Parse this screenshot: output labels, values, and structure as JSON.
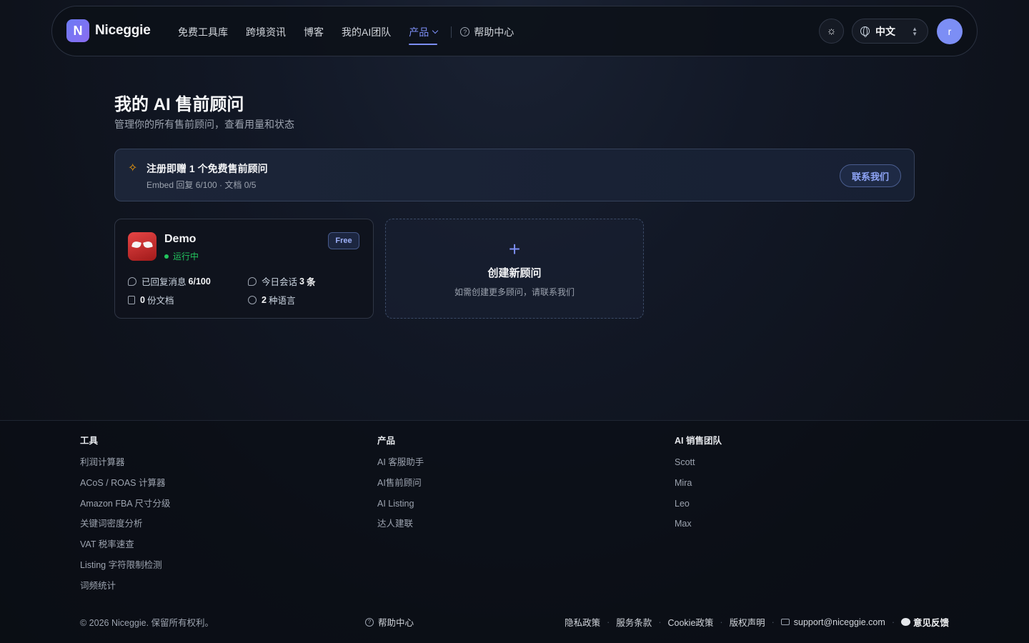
{
  "nav": {
    "logo_letter": "N",
    "logo_text": "Niceggie",
    "items": [
      {
        "label": "免费工具库"
      },
      {
        "label": "跨境资讯"
      },
      {
        "label": "博客"
      },
      {
        "label": "我的AI团队"
      },
      {
        "label": "产品",
        "active": true
      }
    ],
    "help_label": "帮助中心",
    "language": "中文",
    "avatar_letter": "r",
    "accent_color": "#7c8ef5"
  },
  "header": {
    "title": "我的 AI 售前顾问",
    "subtitle": "管理你的所有售前顾问，查看用量和状态"
  },
  "banner": {
    "title": "注册即赠 1 个免费售前顾问",
    "meta": "Embed 回复 6/100 · 文档 0/5",
    "button": "联系我们"
  },
  "advisor_card": {
    "name": "Demo",
    "status": "运行中",
    "badge": "Free",
    "replied_label": "已回复消息",
    "replied_value": "6/100",
    "today_label": "今日会话",
    "today_value": "3",
    "today_unit": "条",
    "docs_value": "0",
    "docs_label": "份文档",
    "lang_value": "2",
    "lang_label": "种语言"
  },
  "create_card": {
    "plus": "+",
    "title": "创建新顾问",
    "subtitle": "如需创建更多顾问，请联系我们"
  },
  "footer": {
    "tools": {
      "heading": "工具",
      "links": [
        "利润计算器",
        "ACoS / ROAS 计算器",
        "Amazon FBA 尺寸分级",
        "关键词密度分析",
        "VAT 税率速查",
        "Listing 字符限制检测",
        "词频统计"
      ]
    },
    "products": {
      "heading": "产品",
      "links": [
        "AI 客服助手",
        "AI售前顾问",
        "AI Listing",
        "达人建联"
      ]
    },
    "team": {
      "heading": "AI 销售团队",
      "links": [
        "Scott",
        "Mira",
        "Leo",
        "Max"
      ]
    },
    "copyright": "© 2026 Niceggie. 保留所有权利。",
    "help": "帮助中心",
    "legal": [
      "隐私政策",
      "服务条款",
      "Cookie政策",
      "版权声明"
    ],
    "email": "support@niceggie.com",
    "feedback": "意见反馈"
  }
}
